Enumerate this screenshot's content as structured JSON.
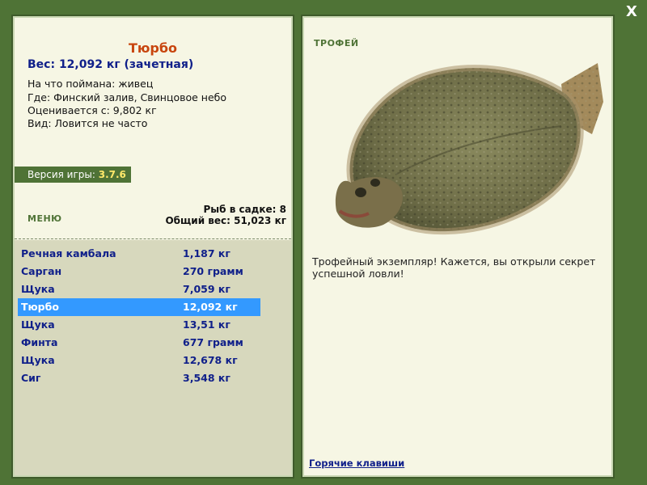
{
  "close": {
    "label": "X"
  },
  "fish": {
    "title": "Тюрбо",
    "weight": "Вес: 12,092 кг (зачетная)",
    "bait": "На что поймана: живец",
    "location": "Где: Финский залив, Свинцовое небо",
    "threshold": "Оценивается с: 9,802 кг",
    "rarity": "Вид: Ловится не часто"
  },
  "version": {
    "label": "Версия игры:",
    "value": "3.7.6"
  },
  "menu": {
    "label": "МЕНЮ"
  },
  "summary": {
    "count": "Рыб в садке: 8",
    "total": "Общий вес: 51,023 кг"
  },
  "catch": [
    {
      "name": "Речная камбала",
      "weight": "1,187 кг"
    },
    {
      "name": "Сарган",
      "weight": "270 грамм"
    },
    {
      "name": "Щука",
      "weight": "7,059 кг"
    },
    {
      "name": "Тюрбо",
      "weight": "12,092 кг",
      "selected": true
    },
    {
      "name": "Щука",
      "weight": "13,51 кг"
    },
    {
      "name": "Финта",
      "weight": "677 грамм"
    },
    {
      "name": "Щука",
      "weight": "12,678 кг"
    },
    {
      "name": "Сиг",
      "weight": "3,548 кг"
    }
  ],
  "trophy": {
    "label": "ТРОФЕЙ",
    "text": "Трофейный экземпляр! Кажется, вы открыли секрет успешной ловли!"
  },
  "hotkeys": {
    "label": "Горячие клавиши"
  },
  "colors": {
    "background": "#4f7336",
    "panel": "#f6f6e4",
    "selection": "#3399ff",
    "title": "#c8450e",
    "text_blue": "#10208a"
  }
}
